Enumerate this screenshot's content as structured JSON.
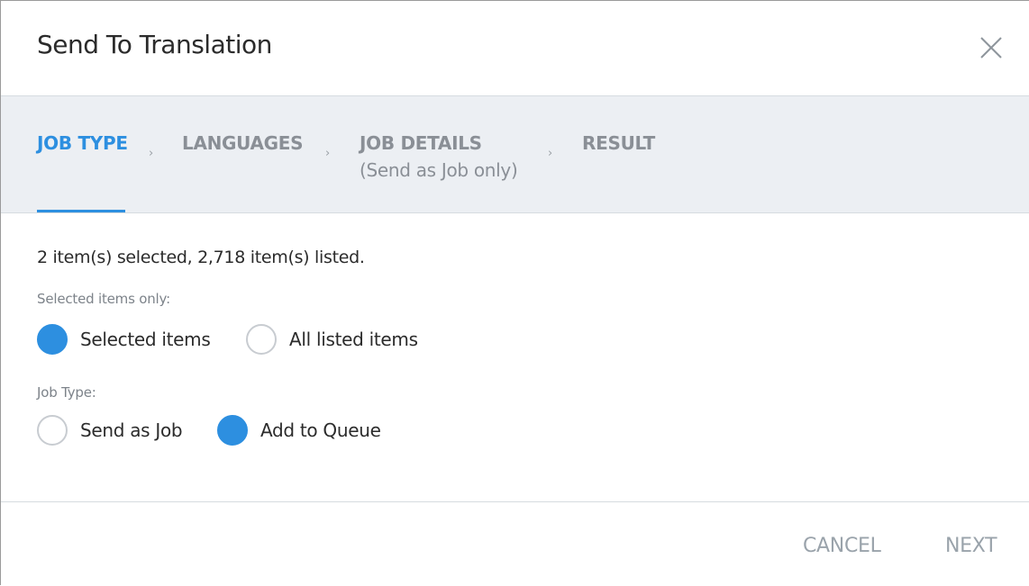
{
  "dialog": {
    "title": "Send To Translation"
  },
  "icons": {
    "close": "close-icon",
    "step_separator": "chevron-right-icon"
  },
  "colors": {
    "accent": "#2d8fe0",
    "stepper_background": "#eceff3",
    "muted_text": "#8a8f96"
  },
  "stepper": {
    "steps": [
      {
        "label": "JOB TYPE",
        "active": true
      },
      {
        "label": "LANGUAGES",
        "active": false
      },
      {
        "label": "JOB DETAILS",
        "sublabel": "(Send as Job only)",
        "active": false
      },
      {
        "label": "RESULT",
        "active": false
      }
    ],
    "separator": "›"
  },
  "content": {
    "summary": "2 item(s) selected, 2,718 item(s) listed.",
    "selection_group": {
      "label": "Selected items only:",
      "options": [
        {
          "label": "Selected items",
          "checked": true
        },
        {
          "label": "All listed items",
          "checked": false
        }
      ]
    },
    "job_type_group": {
      "label": "Job Type:",
      "options": [
        {
          "label": "Send as Job",
          "checked": false
        },
        {
          "label": "Add to Queue",
          "checked": true
        }
      ]
    }
  },
  "footer": {
    "cancel_label": "CANCEL",
    "next_label": "NEXT"
  }
}
